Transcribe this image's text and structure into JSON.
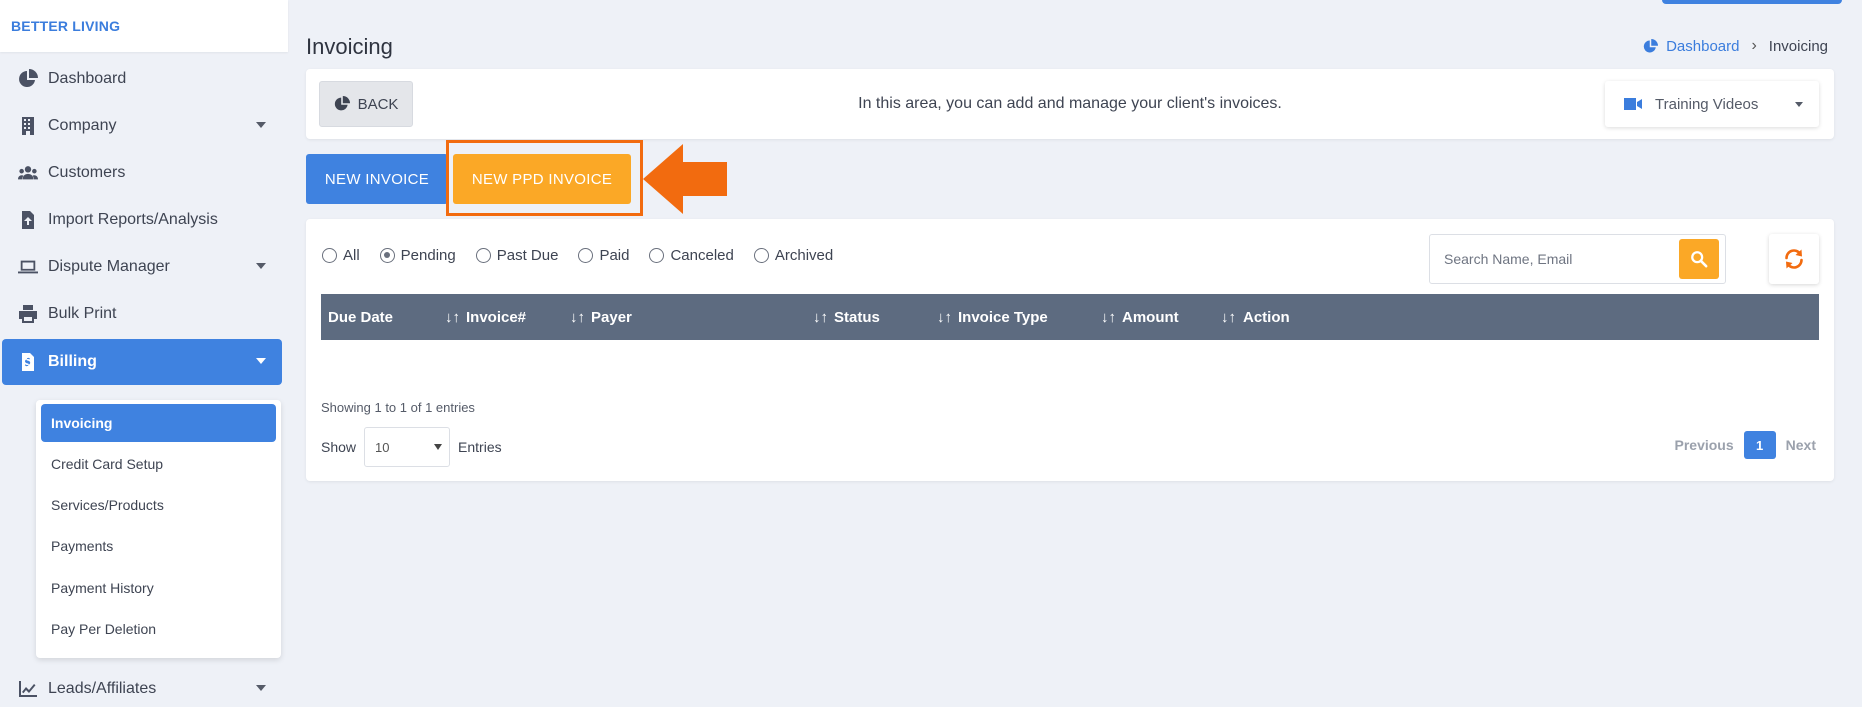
{
  "brand": "BETTER LIVING",
  "sidebar": {
    "items": [
      {
        "label": "Dashboard",
        "icon": "pie-chart-icon"
      },
      {
        "label": "Company",
        "icon": "building-icon"
      },
      {
        "label": "Customers",
        "icon": "users-icon"
      },
      {
        "label": "Import Reports/Analysis",
        "icon": "file-upload-icon"
      },
      {
        "label": "Dispute Manager",
        "icon": "laptop-icon"
      },
      {
        "label": "Bulk Print",
        "icon": "printer-icon"
      },
      {
        "label": "Billing",
        "icon": "invoice-icon"
      },
      {
        "label": "Leads/Affiliates",
        "icon": "line-chart-icon"
      }
    ],
    "billing_submenu": [
      "Invoicing",
      "Credit Card Setup",
      "Services/Products",
      "Payments",
      "Payment History",
      "Pay Per Deletion"
    ]
  },
  "header": {
    "title": "Invoicing",
    "breadcrumb": {
      "home": "Dashboard",
      "current": "Invoicing"
    }
  },
  "info_bar": {
    "back_label": "BACK",
    "message": "In this area, you can add and manage your client's invoices.",
    "training_label": "Training Videos"
  },
  "actions": {
    "new_invoice": "NEW INVOICE",
    "new_ppd_invoice": "NEW PPD INVOICE"
  },
  "filters": {
    "options": [
      "All",
      "Pending",
      "Past Due",
      "Paid",
      "Canceled",
      "Archived"
    ],
    "selected": "Pending"
  },
  "search": {
    "placeholder": "Search Name, Email"
  },
  "table": {
    "columns": [
      "Due Date",
      "Invoice#",
      "Payer",
      "Status",
      "Invoice Type",
      "Amount",
      "Action"
    ]
  },
  "footer": {
    "showing": "Showing 1 to 1 of 1 entries",
    "show_label": "Show",
    "page_size": "10",
    "entries_label": "Entries",
    "previous": "Previous",
    "current_page": "1",
    "next": "Next"
  },
  "colors": {
    "primary": "#3f82e0",
    "accent": "#fba826",
    "highlight": "#f26b0f",
    "table_header": "#5d6b80"
  }
}
